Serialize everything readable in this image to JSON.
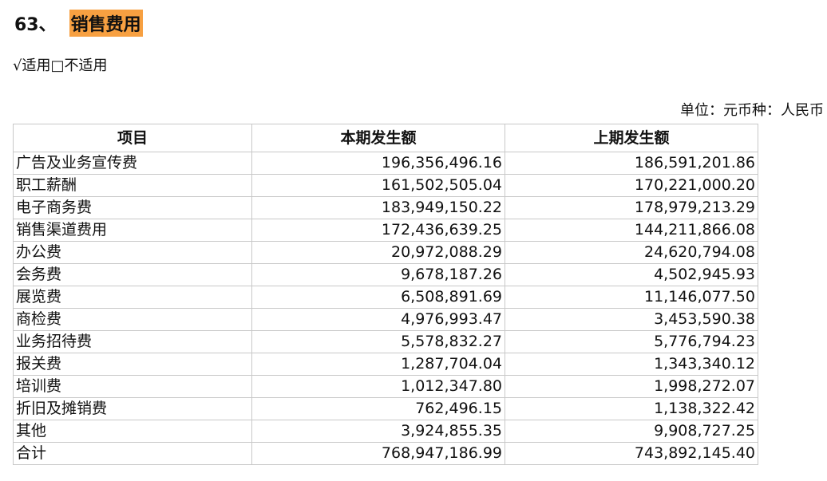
{
  "section": {
    "number": "63、",
    "title": "销售费用"
  },
  "applicability": "√适用□不适用",
  "unit_note": "单位：元币种：人民币",
  "table": {
    "headers": [
      "项目",
      "本期发生额",
      "上期发生额"
    ],
    "rows": [
      {
        "item": "广告及业务宣传费",
        "current": "196,356,496.16",
        "prior": "186,591,201.86"
      },
      {
        "item": "职工薪酬",
        "current": "161,502,505.04",
        "prior": "170,221,000.20"
      },
      {
        "item": "电子商务费",
        "current": "183,949,150.22",
        "prior": "178,979,213.29"
      },
      {
        "item": "销售渠道费用",
        "current": "172,436,639.25",
        "prior": "144,211,866.08"
      },
      {
        "item": "办公费",
        "current": "20,972,088.29",
        "prior": "24,620,794.08"
      },
      {
        "item": "会务费",
        "current": "9,678,187.26",
        "prior": "4,502,945.93"
      },
      {
        "item": "展览费",
        "current": "6,508,891.69",
        "prior": "11,146,077.50"
      },
      {
        "item": "商检费",
        "current": "4,976,993.47",
        "prior": "3,453,590.38"
      },
      {
        "item": "业务招待费",
        "current": "5,578,832.27",
        "prior": "5,776,794.23"
      },
      {
        "item": "报关费",
        "current": "1,287,704.04",
        "prior": "1,343,340.12"
      },
      {
        "item": "培训费",
        "current": "1,012,347.80",
        "prior": "1,998,272.07"
      },
      {
        "item": "折旧及摊销费",
        "current": "762,496.15",
        "prior": "1,138,322.42"
      },
      {
        "item": "其他",
        "current": "3,924,855.35",
        "prior": "9,908,727.25"
      },
      {
        "item": "合计",
        "current": "768,947,186.99",
        "prior": "743,892,145.40"
      }
    ]
  },
  "colors": {
    "title_highlight": "#f7a041",
    "table_border": "#c8c8c8"
  }
}
